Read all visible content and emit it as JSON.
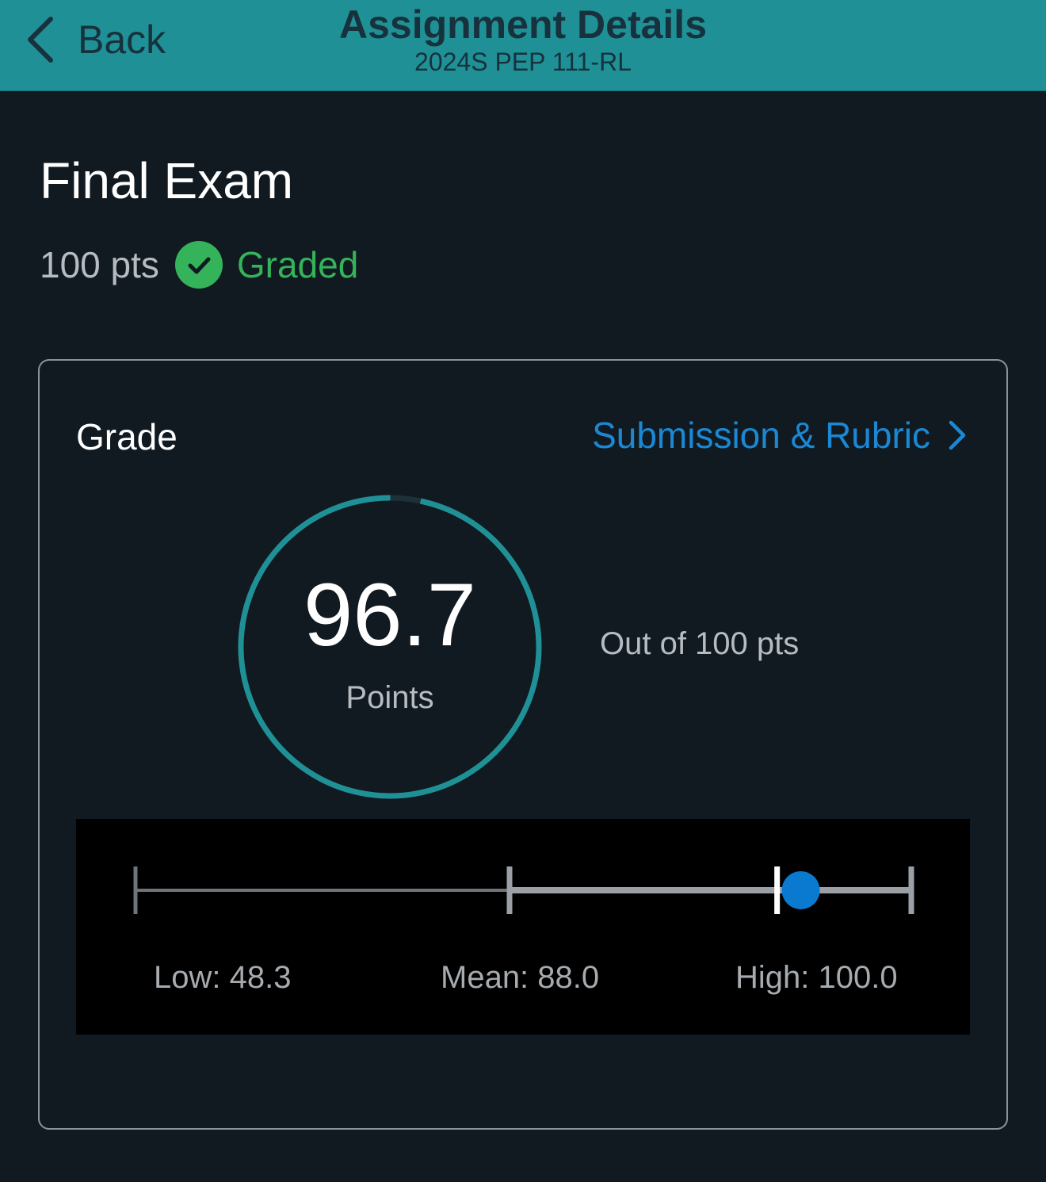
{
  "header": {
    "back_label": "Back",
    "title": "Assignment Details",
    "subtitle": "2024S PEP 111-RL"
  },
  "assignment": {
    "title": "Final Exam",
    "points_possible": "100 pts",
    "status": "Graded"
  },
  "grade_card": {
    "label": "Grade",
    "link_label": "Submission & Rubric",
    "score": "96.7",
    "score_unit": "Points",
    "out_of": "Out of 100 pts",
    "score_fraction": 0.967
  },
  "statistics": {
    "low_label": "Low: 48.3",
    "mean_label": "Mean: 88.0",
    "high_label": "High: 100.0",
    "low": 48.3,
    "mean": 88.0,
    "high": 100.0,
    "score": 96.7,
    "scale_min": 0,
    "scale_max": 100
  },
  "colors": {
    "header_bg": "#1f9196",
    "page_bg": "#111a21",
    "accent_link": "#1b88d4",
    "graded_green": "#34b35a",
    "ring_teal": "#1f9196",
    "marker_blue": "#0a7ad0"
  },
  "icons": {
    "back": "chevron-left-icon",
    "graded": "check-circle-icon",
    "link": "chevron-right-icon"
  }
}
